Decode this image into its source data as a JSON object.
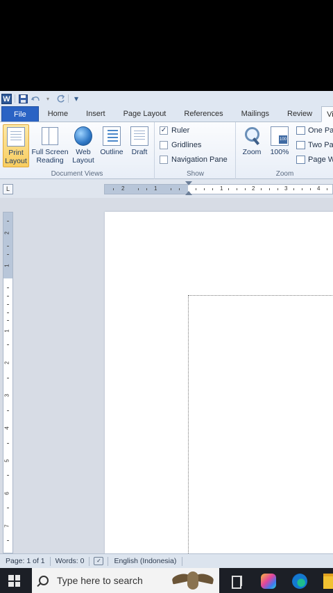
{
  "quick_access": {
    "app_icon_letter": "W",
    "save": "save-icon",
    "undo": "undo-icon",
    "redo": "redo-icon",
    "customize": "▾"
  },
  "tabs": [
    "File",
    "Home",
    "Insert",
    "Page Layout",
    "References",
    "Mailings",
    "Review",
    "Vi"
  ],
  "ribbon": {
    "document_views": {
      "label": "Document Views",
      "print_layout": "Print Layout",
      "full_screen_reading": "Full Screen Reading",
      "web_layout": "Web Layout",
      "outline": "Outline",
      "draft": "Draft"
    },
    "show": {
      "label": "Show",
      "ruler": "Ruler",
      "ruler_checked": true,
      "gridlines": "Gridlines",
      "gridlines_checked": false,
      "navigation_pane": "Navigation Pane",
      "navigation_pane_checked": false
    },
    "zoom": {
      "label": "Zoom",
      "zoom": "Zoom",
      "hundred": "100%",
      "one_page": "One Pa",
      "two_pages": "Two Pa",
      "page_width": "Page W"
    }
  },
  "ruler": {
    "tab_selector": "L",
    "h_numbers": [
      "2",
      "1",
      "1",
      "2",
      "3",
      "4"
    ],
    "v_numbers": [
      "2",
      "1",
      "1",
      "2",
      "3",
      "4",
      "5",
      "6",
      "7"
    ]
  },
  "status": {
    "page": "Page: 1 of 1",
    "words": "Words: 0",
    "language": "English (Indonesia)"
  },
  "taskbar": {
    "search_placeholder": "Type here to search"
  },
  "colors": {
    "file_tab": "#2a63c4",
    "selected_button": "#f8cd5f",
    "taskbar": "#1c1f26"
  }
}
